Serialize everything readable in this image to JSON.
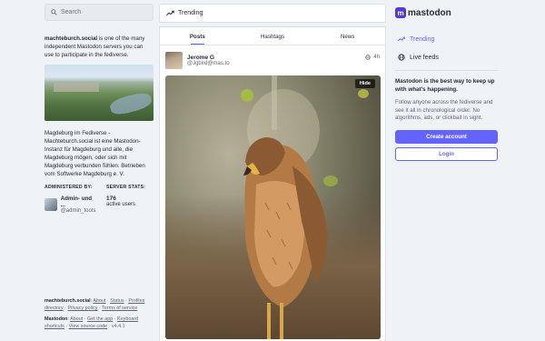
{
  "search": {
    "placeholder": "Search"
  },
  "about": {
    "server": "machteburch.social",
    "text": " is one of the many independent Mastodon servers you can use to participate in the fediverse.",
    "description": "Magdeburg im Fediverse - Machteburch.social ist eine Mastodon-Instanz für Magdeburg und alle, die Magdeburg mögen, oder sich mit Magdeburg verbunden fühlen. Betrieben vom Softwerke Magdeburg e. V."
  },
  "admin": {
    "heading": "ADMINISTERED BY:",
    "name": "Admin- und ...",
    "handle": "@admin_toots"
  },
  "stats": {
    "heading": "SERVER STATS:",
    "users_count": "176",
    "users_label": "active users"
  },
  "footer": {
    "server": "machteburch.social",
    "links1": [
      "About",
      "Status",
      "Profiles directory",
      "Privacy policy",
      "Terms of service"
    ],
    "brand": "Mastodon",
    "links2": [
      "About",
      "Get the app",
      "Keyboard shortcuts",
      "View source code"
    ],
    "version": "v4.4.1"
  },
  "center": {
    "title": "Trending",
    "tabs": [
      {
        "label": "Posts"
      },
      {
        "label": "Hashtags"
      },
      {
        "label": "News"
      }
    ],
    "post": {
      "author": "Jerome G",
      "handle": "@Jgbird@mas.to",
      "time": "4h",
      "hide_label": "Hide"
    }
  },
  "right": {
    "logo_mark": "m",
    "logo_text": "mastodon",
    "nav": [
      {
        "label": "Trending",
        "icon": "trending-icon"
      },
      {
        "label": "Live feeds",
        "icon": "globe-icon"
      }
    ],
    "pitch": "Mastodon is the best way to keep up with what's happening.",
    "pitch_sub": "Follow anyone across the fediverse and see it all in chronological order. No algorithms, ads, or clickbait in sight.",
    "create_account": "Create account",
    "login": "Login"
  },
  "colors": {
    "accent": "#6364ff",
    "background": "#eff3f5",
    "logo": "#563acc"
  }
}
